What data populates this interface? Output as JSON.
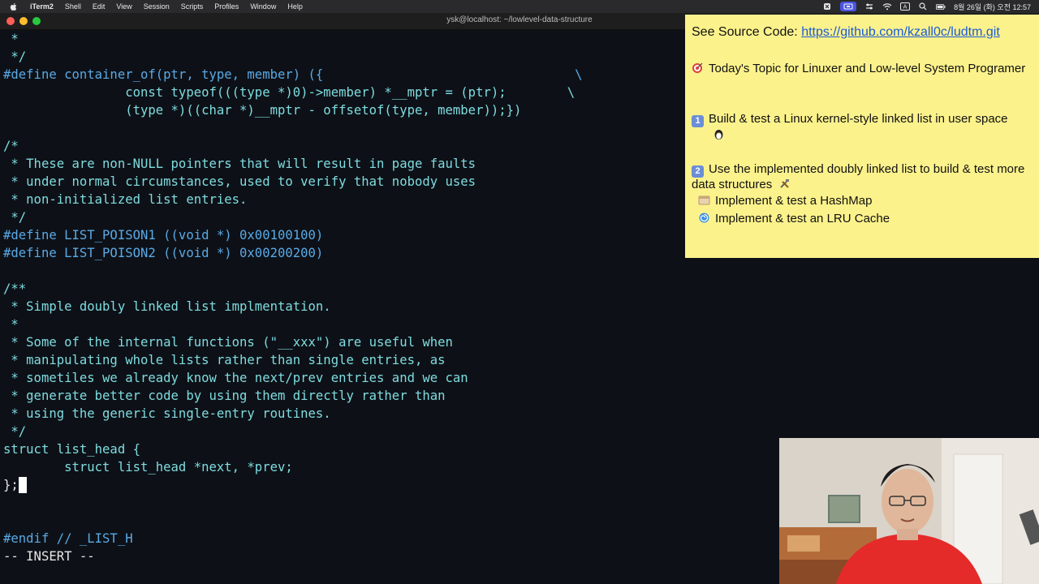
{
  "menubar": {
    "app": "iTerm2",
    "items": [
      "Shell",
      "Edit",
      "View",
      "Session",
      "Scripts",
      "Profiles",
      "Window",
      "Help"
    ],
    "clock": "8월 26일 (화) 오전 12:57"
  },
  "window": {
    "title": "ysk@localhost: ~/lowlevel-data-structure"
  },
  "terminal": {
    "lines": [
      " *",
      " */",
      "#define container_of(ptr, type, member) ({                                 \\",
      "                const typeof(((type *)0)->member) *__mptr = (ptr);        \\",
      "                (type *)((char *)__mptr - offsetof(type, member));})",
      "",
      "/*",
      " * These are non-NULL pointers that will result in page faults",
      " * under normal circumstances, used to verify that nobody uses",
      " * non-initialized list entries.",
      " */",
      "#define LIST_POISON1 ((void *) 0x00100100)",
      "#define LIST_POISON2 ((void *) 0x00200200)",
      "",
      "/**",
      " * Simple doubly linked list implmentation.",
      " *",
      " * Some of the internal functions (\"__xxx\") are useful when",
      " * manipulating whole lists rather than single entries, as",
      " * sometiles we already know the next/prev entries and we can",
      " * generate better code by using them directly rather than",
      " * using the generic single-entry routines.",
      " */",
      "struct list_head {",
      "        struct list_head *next, *prev;",
      "};",
      "",
      "",
      "#endif // _LIST_H",
      "-- INSERT --"
    ],
    "mode": "-- INSERT --"
  },
  "notes": {
    "source_label": "See Source Code: ",
    "source_link": "https://github.com/kzall0c/ludtm.git",
    "topic": "Today's Topic for Linuxer and Low-level System Programer",
    "step1": "Build & test a Linux kernel-style linked list in user space",
    "step2": "Use the implemented doubly linked list to build & test more data structures",
    "sub1": "Implement & test a HashMap",
    "sub2": "Implement & test an LRU Cache",
    "key1": "1",
    "key2": "2"
  }
}
